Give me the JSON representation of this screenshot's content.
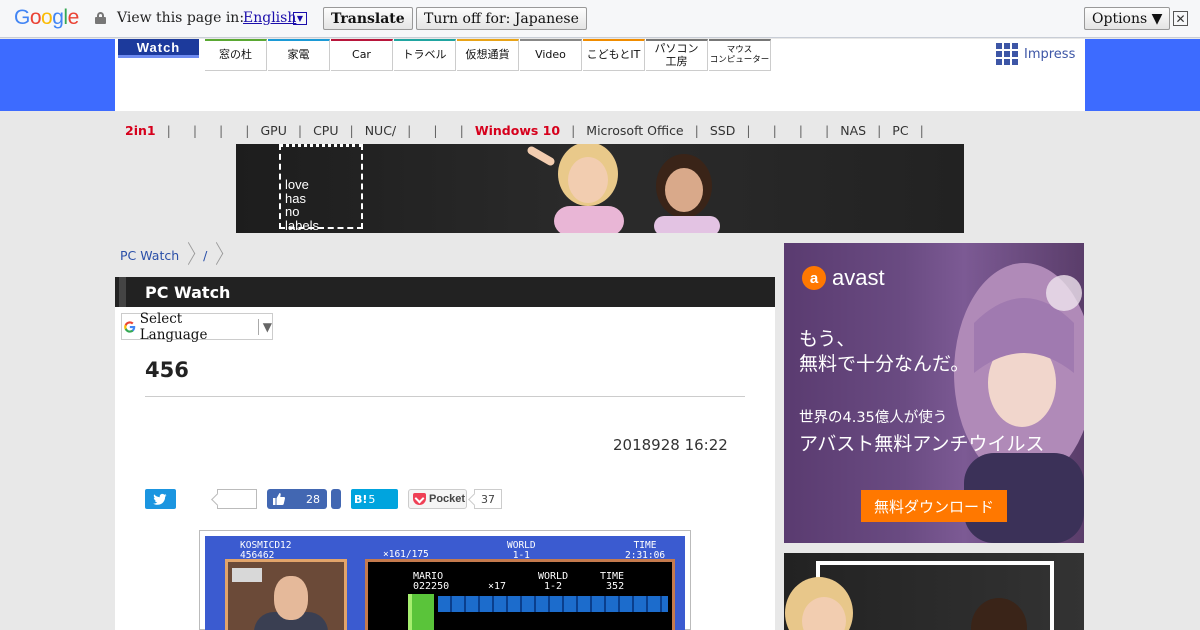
{
  "translate_bar": {
    "logo": "Google",
    "prompt": "View this page in:",
    "language": "English",
    "translate_label": "Translate",
    "turn_off_label": "Turn off for: Japanese",
    "options_label": "Options ▼",
    "close_glyph": "✕"
  },
  "header": {
    "logo": "Watch",
    "sites": [
      {
        "label": "窓の杜",
        "color": "#5aa833"
      },
      {
        "label": "家電",
        "color": "#1c9ad6"
      },
      {
        "label": "Car",
        "color": "#b8163b"
      },
      {
        "label": "トラベル",
        "color": "#21a5a1"
      },
      {
        "label": "仮想通貨",
        "color": "#e8a318"
      },
      {
        "label": "Video",
        "color": "#888888"
      },
      {
        "label": "こどもとIT",
        "color": "#f08c00"
      },
      {
        "label": "パソコン\n工房",
        "color": "#777777"
      },
      {
        "label": "マウス\nコンピューター",
        "color": "#777777"
      }
    ],
    "impress_label": "Impress"
  },
  "category_nav": [
    {
      "label": "2in1",
      "red": true
    },
    {
      "label": ""
    },
    {
      "label": ""
    },
    {
      "label": ""
    },
    {
      "label": "GPU"
    },
    {
      "label": "CPU"
    },
    {
      "label": "NUC/"
    },
    {
      "label": ""
    },
    {
      "label": ""
    },
    {
      "label": "Windows 10",
      "red": true
    },
    {
      "label": "Microsoft Office"
    },
    {
      "label": "SSD"
    },
    {
      "label": ""
    },
    {
      "label": ""
    },
    {
      "label": ""
    },
    {
      "label": "NAS"
    },
    {
      "label": "PC"
    }
  ],
  "banner": {
    "text_line1": "love",
    "text_line2": "has",
    "text_line3": "no",
    "text_line4": "labels"
  },
  "breadcrumb": [
    "PC Watch",
    "/"
  ],
  "section_title": "PC Watch",
  "select_language": "Select Language",
  "article": {
    "title": "456",
    "date": "2018928 16:22"
  },
  "share": {
    "facebook_count": "28",
    "hatena_label": "B!",
    "hatena_count": "5",
    "pocket_label": "Pocket",
    "pocket_count": "37"
  },
  "game_image": {
    "player": "KOSMICD12",
    "score_top": "456462",
    "stars": "×161/175",
    "world_label": "WORLD",
    "world_top": "1-1",
    "time_label": "TIME",
    "time_top": "2:31:06",
    "mario": "MARIO",
    "mario_score": "022250",
    "coins": "×17",
    "world_inner": "1-2",
    "time_inner": "352"
  },
  "avast_ad": {
    "brand": "avast",
    "brand_glyph": "a",
    "line1": "もう、",
    "line2": "無料で十分なんだ。",
    "line3": "世界の4.35億人が使う",
    "line4": "アバスト無料アンチウイルス",
    "cta": "無料ダウンロード"
  }
}
